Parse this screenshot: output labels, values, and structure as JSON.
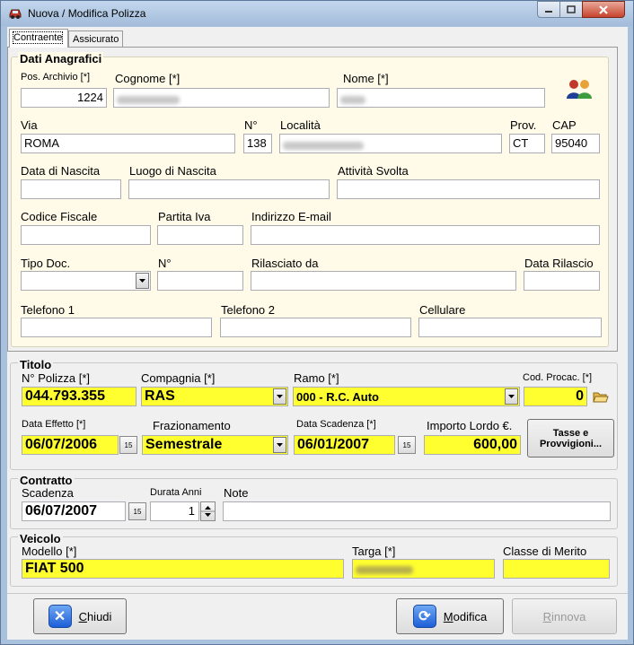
{
  "window": {
    "title": "Nuova / Modifica Polizza"
  },
  "tabs": [
    {
      "label": "Contraente"
    },
    {
      "label": "Assicurato"
    }
  ],
  "anagrafica": {
    "legend": "Dati Anagrafici",
    "pos_archivio": {
      "label": "Pos. Archivio [*]",
      "value": "1224"
    },
    "cognome": {
      "label": "Cognome [*]"
    },
    "nome": {
      "label": "Nome [*]"
    },
    "via": {
      "label": "Via",
      "value": "ROMA"
    },
    "numero": {
      "label": "N°",
      "value": "138"
    },
    "localita": {
      "label": "Località"
    },
    "prov": {
      "label": "Prov.",
      "value": "CT"
    },
    "cap": {
      "label": "CAP",
      "value": "95040"
    },
    "data_nascita": {
      "label": "Data di Nascita",
      "value": ""
    },
    "luogo_nascita": {
      "label": "Luogo di Nascita",
      "value": ""
    },
    "attivita": {
      "label": "Attività Svolta",
      "value": ""
    },
    "codice_fiscale": {
      "label": "Codice Fiscale",
      "value": ""
    },
    "partita_iva": {
      "label": "Partita Iva",
      "value": ""
    },
    "email": {
      "label": "Indirizzo E-mail",
      "value": ""
    },
    "tipo_doc": {
      "label": "Tipo Doc.",
      "value": ""
    },
    "num_doc": {
      "label": "N°",
      "value": ""
    },
    "rilasciato_da": {
      "label": "Rilasciato da",
      "value": ""
    },
    "data_rilascio": {
      "label": "Data Rilascio",
      "value": ""
    },
    "telefono1": {
      "label": "Telefono 1",
      "value": ""
    },
    "telefono2": {
      "label": "Telefono 2",
      "value": ""
    },
    "cellulare": {
      "label": "Cellulare",
      "value": ""
    }
  },
  "titolo": {
    "legend": "Titolo",
    "n_polizza": {
      "label": "N° Polizza [*]",
      "value": "044.793.355"
    },
    "compagnia": {
      "label": "Compagnia [*]",
      "value": "RAS"
    },
    "ramo": {
      "label": "Ramo [*]",
      "value": "000 - R.C. Auto"
    },
    "cod_procac": {
      "label": "Cod. Procac. [*]",
      "value": "0"
    },
    "data_effetto": {
      "label": "Data Effetto [*]",
      "value": "06/07/2006"
    },
    "frazionamento": {
      "label": "Frazionamento",
      "value": "Semestrale"
    },
    "data_scadenza": {
      "label": "Data Scadenza [*]",
      "value": "06/01/2007"
    },
    "importo_lordo": {
      "label": "Importo Lordo €.",
      "value": "600,00"
    },
    "tasse_button": {
      "line1": "Tasse e",
      "line2": "Provvigioni..."
    }
  },
  "contratto": {
    "legend": "Contratto",
    "scadenza": {
      "label": "Scadenza",
      "value": "06/07/2007"
    },
    "durata_anni": {
      "label": "Durata Anni",
      "value": "1"
    },
    "note": {
      "label": "Note",
      "value": ""
    }
  },
  "veicolo": {
    "legend": "Veicolo",
    "modello": {
      "label": "Modello [*]",
      "value": "FIAT 500"
    },
    "targa": {
      "label": "Targa [*]"
    },
    "classe_merito": {
      "label": "Classe di Merito",
      "value": ""
    }
  },
  "buttons": {
    "chiudi": {
      "accel": "C",
      "rest": "hiudi"
    },
    "modifica": {
      "accel": "M",
      "rest": "odifica"
    },
    "rinnova": {
      "accel": "R",
      "rest": "innova"
    }
  },
  "colors": {
    "required_field": "#ffff2f",
    "window_frame": "#a9c1dd",
    "button_icon": "#1d5ed8"
  },
  "icons": {
    "app": "car-icon",
    "contacts": "people-icon",
    "folder": "open-folder-icon",
    "calendar": "calendar-icon"
  }
}
